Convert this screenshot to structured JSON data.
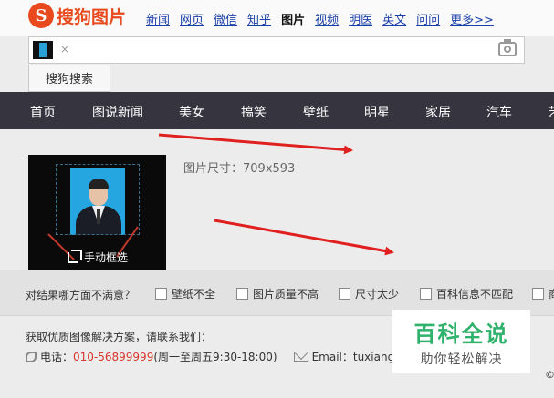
{
  "header": {
    "logo_mark": "S",
    "logo_text": "搜狗图片",
    "nav": [
      {
        "label": "新闻",
        "active": false
      },
      {
        "label": "网页",
        "active": false
      },
      {
        "label": "微信",
        "active": false
      },
      {
        "label": "知乎",
        "active": false
      },
      {
        "label": "图片",
        "active": true
      },
      {
        "label": "视频",
        "active": false
      },
      {
        "label": "明医",
        "active": false
      },
      {
        "label": "英文",
        "active": false
      },
      {
        "label": "问问",
        "active": false
      },
      {
        "label": "更多>>",
        "active": false
      }
    ]
  },
  "search": {
    "close": "×",
    "button_label": "搜狗搜索"
  },
  "categories": [
    "首页",
    "图说新闻",
    "美女",
    "搞笑",
    "壁纸",
    "明星",
    "家居",
    "汽车",
    "艺"
  ],
  "preview": {
    "crop_label": "手动框选",
    "size_text": "图片尺寸：709x593"
  },
  "feedback": {
    "question": "对结果哪方面不满意？",
    "options": [
      "壁纸不全",
      "图片质量不高",
      "尺寸太少",
      "百科信息不匹配",
      "商"
    ]
  },
  "footer": {
    "contact_line": "获取优质图像解决方案，请联系我们：",
    "phone_label": "电话：",
    "phone_number": "010-56899999",
    "phone_hours": " (周一至周五9:30-18:00)",
    "email_label": "Email：",
    "email_value": "tuxiang@s",
    "copyright": "©"
  },
  "watermark": {
    "big": "百科全说",
    "small": "助你轻松解决"
  },
  "colors": {
    "brand": "#e8491d",
    "link": "#1a3fa8",
    "category_bar": "#36343f",
    "arrow": "#e0201e",
    "watermark_green": "#2fb26b"
  }
}
